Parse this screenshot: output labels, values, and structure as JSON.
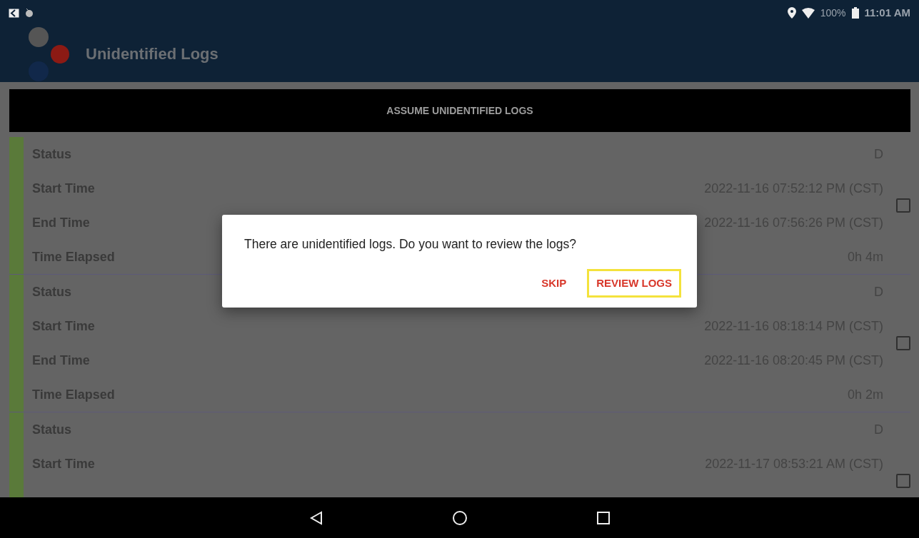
{
  "status_bar": {
    "battery": "100%",
    "time": "11:01 AM"
  },
  "app_bar": {
    "title": "Unidentified Logs"
  },
  "assume_button": "ASSUME UNIDENTIFIED LOGS",
  "logs": [
    {
      "checked": false,
      "fields": [
        {
          "label": "Status",
          "value": "D"
        },
        {
          "label": "Start Time",
          "value": "2022-11-16 07:52:12 PM (CST)"
        },
        {
          "label": "End Time",
          "value": "2022-11-16 07:56:26 PM (CST)"
        },
        {
          "label": "Time Elapsed",
          "value": "0h 4m"
        }
      ]
    },
    {
      "checked": false,
      "fields": [
        {
          "label": "Status",
          "value": "D"
        },
        {
          "label": "Start Time",
          "value": "2022-11-16 08:18:14 PM (CST)"
        },
        {
          "label": "End Time",
          "value": "2022-11-16 08:20:45 PM (CST)"
        },
        {
          "label": "Time Elapsed",
          "value": "0h 2m"
        }
      ]
    },
    {
      "checked": false,
      "fields": [
        {
          "label": "Status",
          "value": "D"
        },
        {
          "label": "Start Time",
          "value": "2022-11-17 08:53:21 AM (CST)"
        }
      ]
    }
  ],
  "dialog": {
    "message": "There are unidentified logs. Do you want to review the logs?",
    "buttons": [
      {
        "label": "SKIP",
        "highlighted": false
      },
      {
        "label": "REVIEW LOGS",
        "highlighted": true
      }
    ]
  }
}
